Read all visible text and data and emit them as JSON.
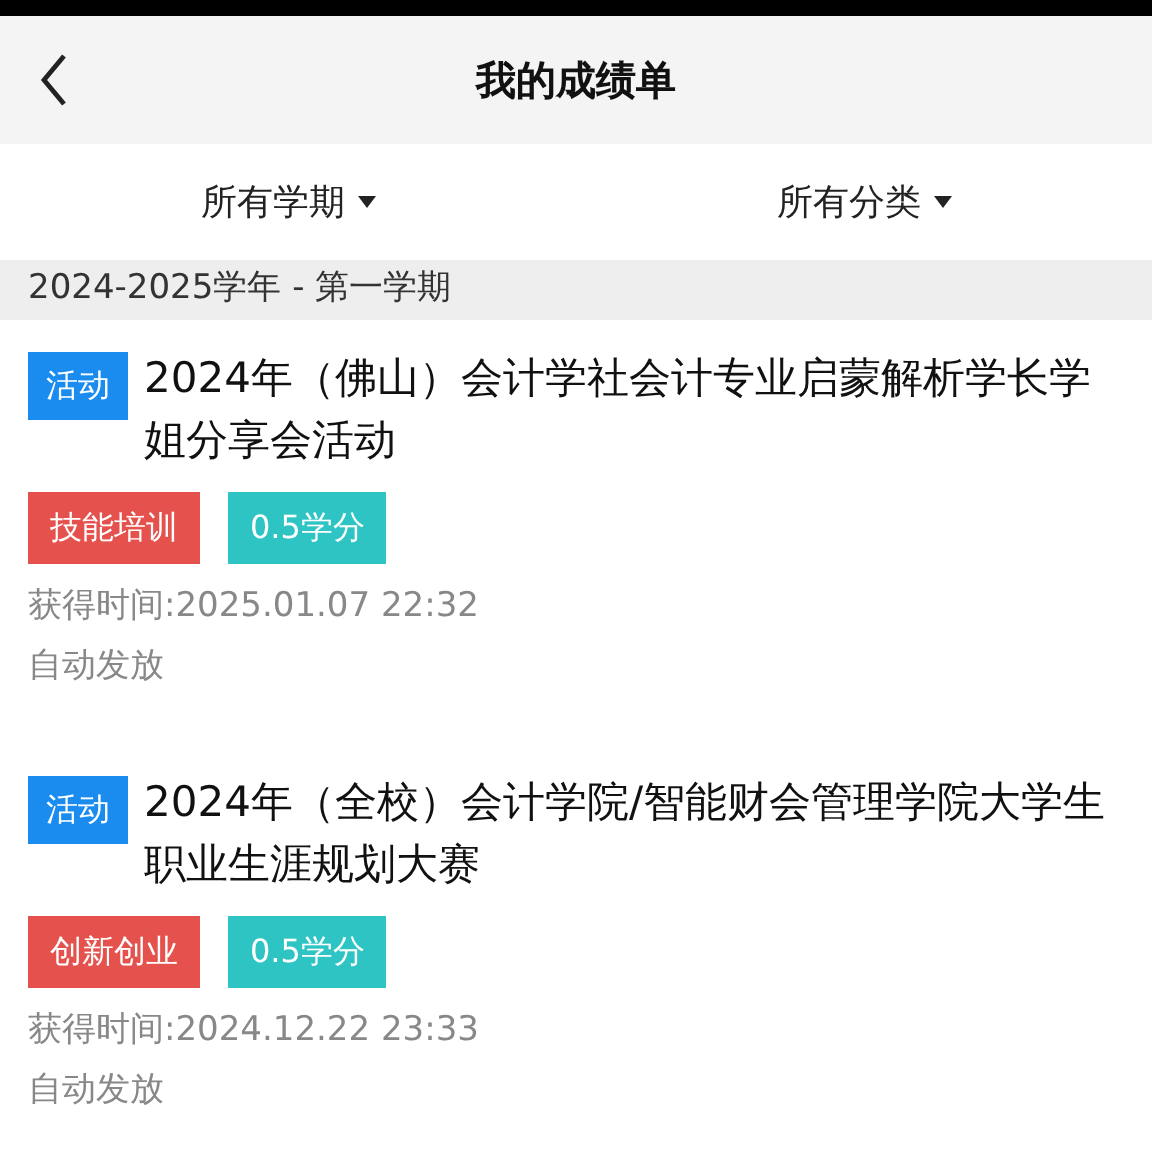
{
  "header": {
    "title": "我的成绩单"
  },
  "filters": [
    {
      "label": "所有学期"
    },
    {
      "label": "所有分类"
    }
  ],
  "section": {
    "title": "2024-2025学年 - 第一学期"
  },
  "records": [
    {
      "badge": {
        "label": "活动",
        "color": "#1a8cf0"
      },
      "title": "2024年（佛山）会计学社会计专业启蒙解析学长学姐分享会活动",
      "tags": [
        {
          "label": "技能培训",
          "color": "#e5514c"
        },
        {
          "label": "0.5学分",
          "color": "#2ec4c4"
        }
      ],
      "time": "获得时间:2025.01.07 22:32",
      "source": "自动发放"
    },
    {
      "badge": {
        "label": "活动",
        "color": "#1a8cf0"
      },
      "title": "2024年（全校）会计学院/智能财会管理学院大学生职业生涯规划大赛",
      "tags": [
        {
          "label": "创新创业",
          "color": "#e5514c"
        },
        {
          "label": "0.5学分",
          "color": "#2ec4c4"
        }
      ],
      "time": "获得时间:2024.12.22 23:33",
      "source": "自动发放"
    }
  ]
}
